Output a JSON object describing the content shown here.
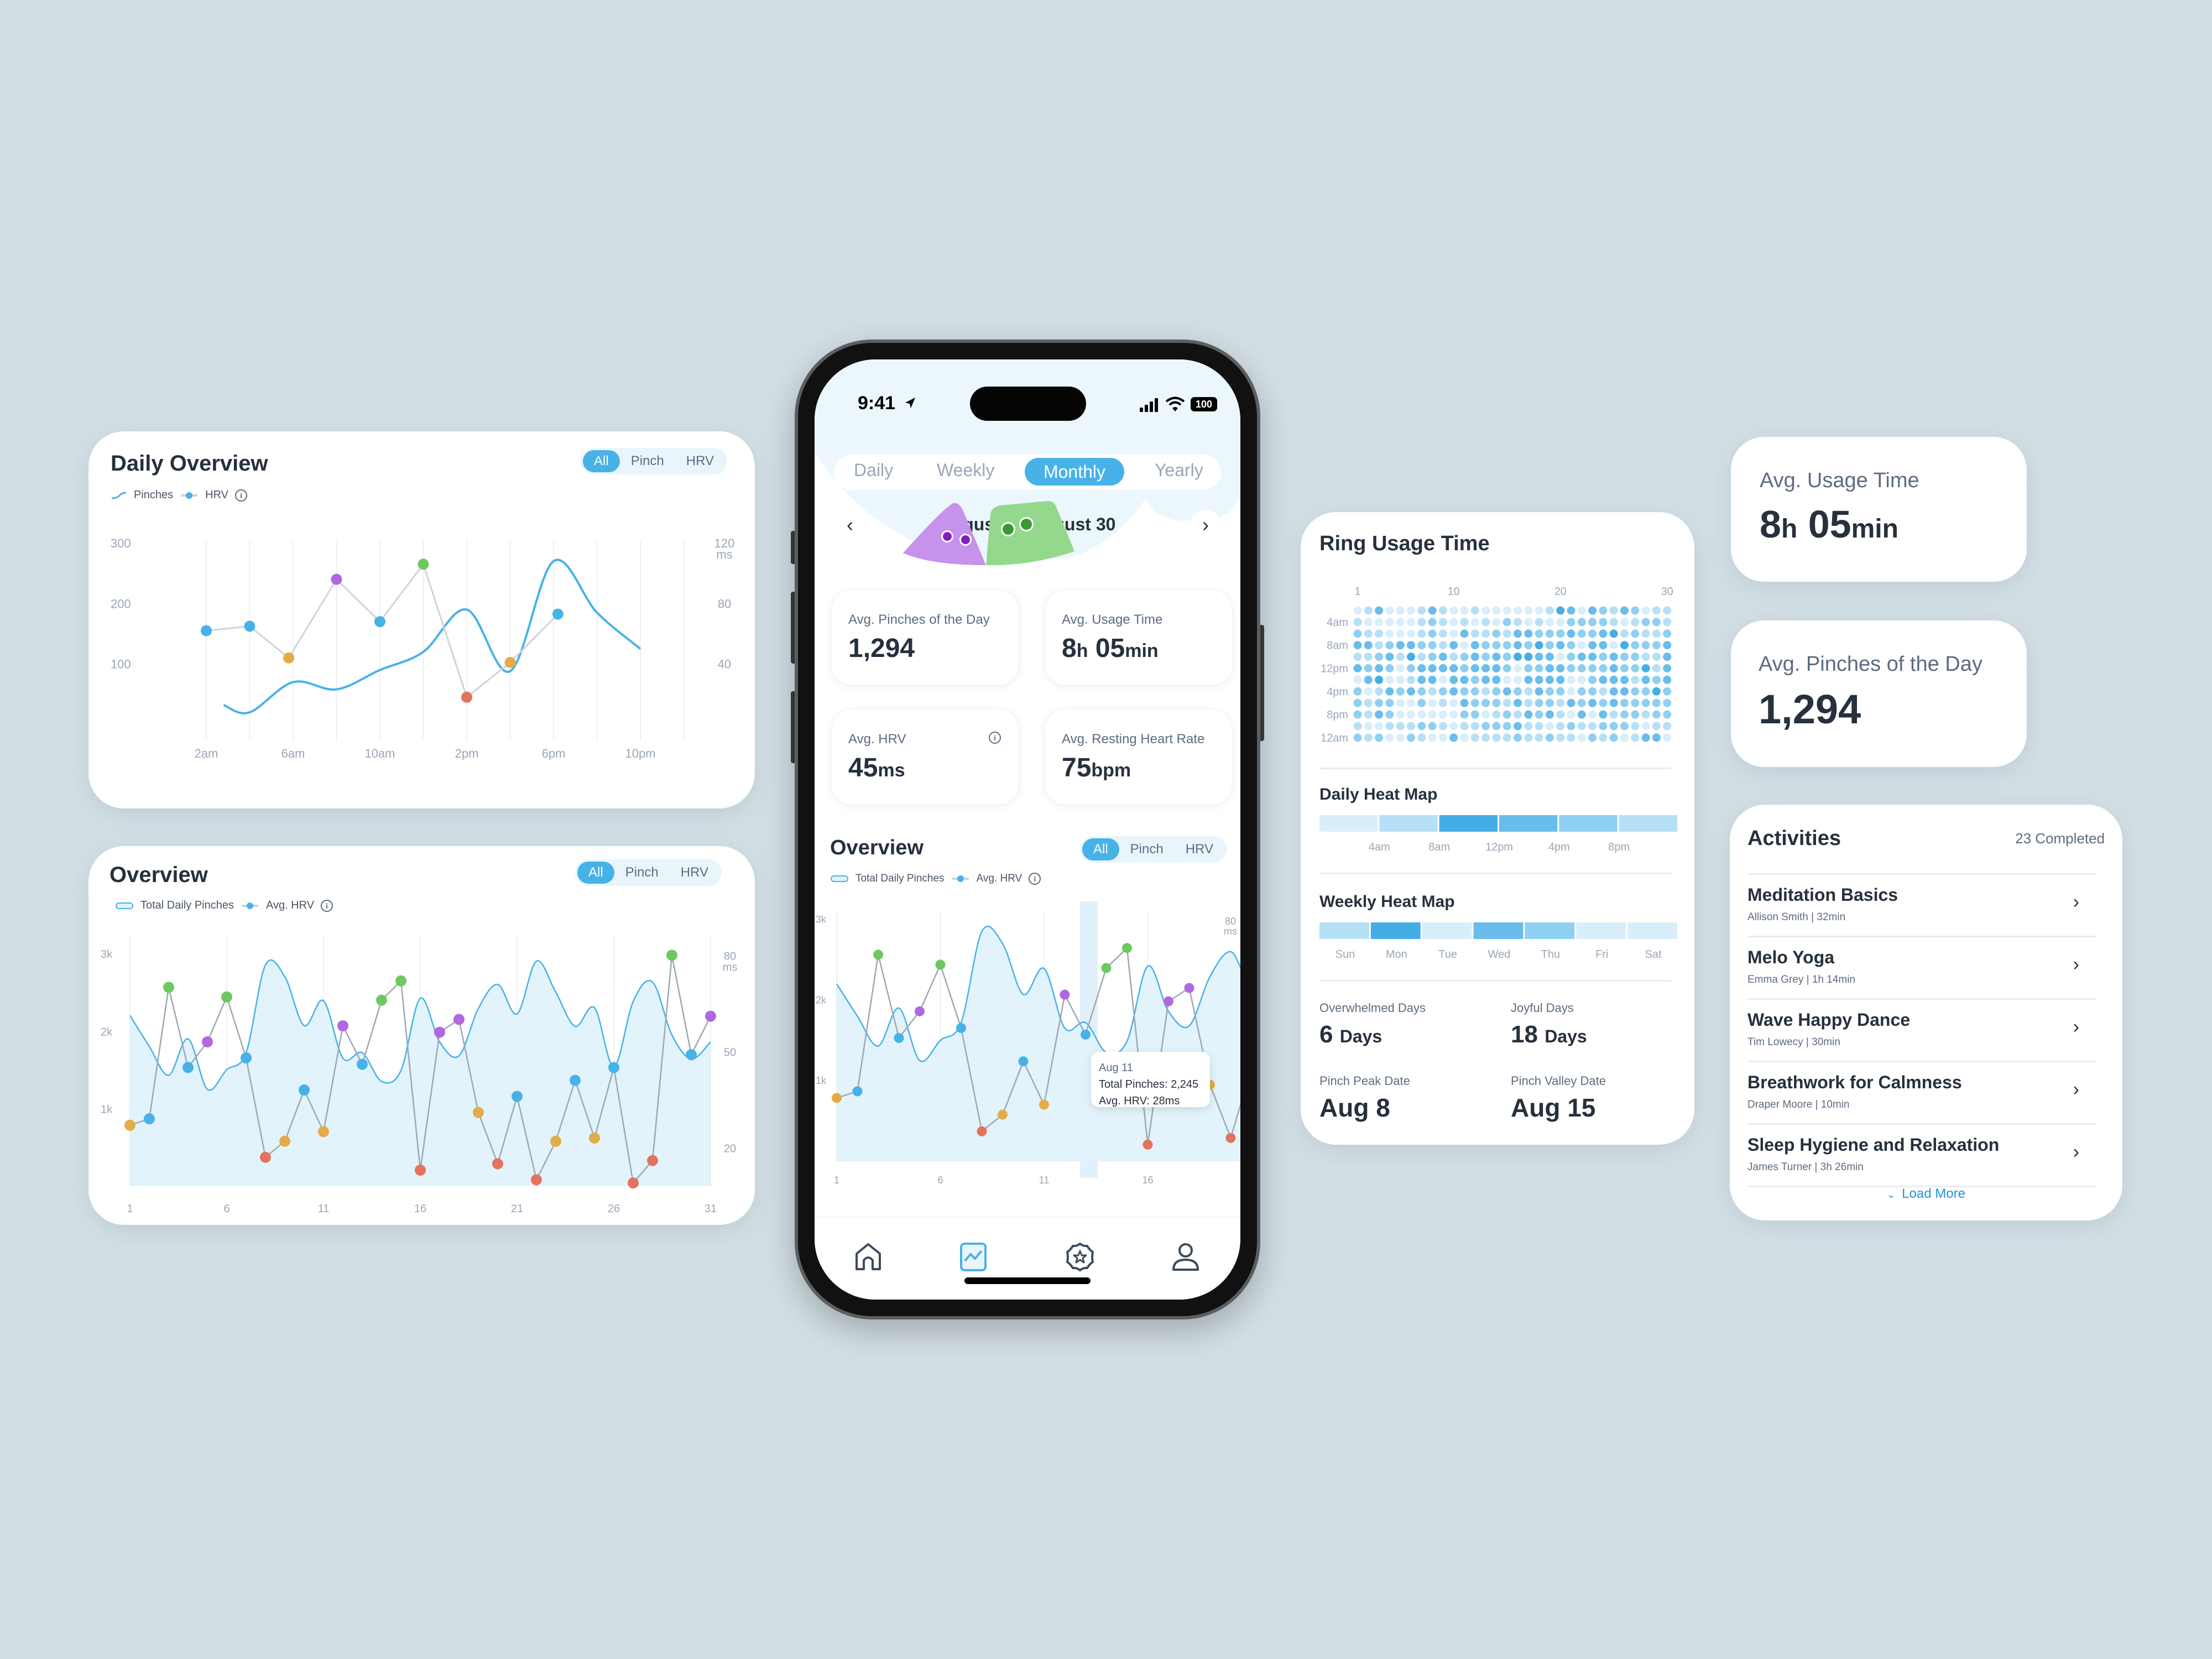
{
  "colors": {
    "background": "#d3dfe5",
    "accent": "#47b2e8",
    "text_dark": "#27303d",
    "text_muted": "#5d6b80",
    "hrv_line": "#a9b2bc",
    "pinch_fill": "#e2f3fb",
    "category": {
      "green": "#6cc95f",
      "blue": "#47b2e8",
      "purple": "#b067e0",
      "orange": "#e2ac47",
      "red": "#e4735e"
    }
  },
  "daily_overview": {
    "title": "Daily Overview",
    "filters": [
      "All",
      "Pinch",
      "HRV"
    ],
    "active_filter": "All",
    "legend": {
      "pinches": "Pinches",
      "hrv": "HRV",
      "info_icon": "info-icon"
    }
  },
  "overview_card": {
    "title": "Overview",
    "filters": [
      "All",
      "Pinch",
      "HRV"
    ],
    "active_filter": "All",
    "legend": {
      "pinches": "Total Daily Pinches",
      "hrv": "Avg. HRV",
      "info_icon": "info-icon"
    }
  },
  "chart_data": [
    {
      "id": "daily_overview",
      "type": "line",
      "title": "Daily Overview",
      "x": [
        "1am",
        "2am",
        "3am",
        "4am",
        "5am",
        "6am",
        "7am",
        "8am",
        "9am",
        "10am",
        "11am",
        "12pm",
        "1pm",
        "2pm",
        "3pm",
        "4pm",
        "5pm",
        "6pm",
        "7pm",
        "8pm",
        "9pm",
        "10pm",
        "11pm",
        "12am"
      ],
      "xticks": [
        "2am",
        "6am",
        "10am",
        "2pm",
        "6pm",
        "10pm"
      ],
      "yticks_left": [
        "100",
        "200",
        "300"
      ],
      "ylim_left": [
        0,
        300
      ],
      "yticks_right": [
        "40",
        "80",
        "120"
      ],
      "ylabel_right": "ms",
      "ylim_right": [
        0,
        120
      ],
      "grid": true,
      "legend": "top-left",
      "series": [
        {
          "name": "Pinches",
          "kind": "smooth-line",
          "points": [
            [
              1.4,
              32
            ],
            [
              2,
              20
            ],
            [
              3,
              70
            ],
            [
              4,
              58
            ],
            [
              5,
              90
            ],
            [
              6,
              120
            ],
            [
              7,
              190
            ],
            [
              8,
              88
            ],
            [
              9,
              270
            ],
            [
              10,
              185
            ],
            [
              11,
              125
            ]
          ]
        },
        {
          "name": "HRV",
          "kind": "line-markers",
          "points": [
            {
              "x": 2,
              "y": 62,
              "cat": "blue"
            },
            {
              "x": 3,
              "y": 65,
              "cat": "blue"
            },
            {
              "x": 3.9,
              "y": 44,
              "cat": "orange"
            },
            {
              "x": 5,
              "y": 96,
              "cat": "purple"
            },
            {
              "x": 6,
              "y": 68,
              "cat": "blue"
            },
            {
              "x": 7,
              "y": 106,
              "cat": "green"
            },
            {
              "x": 8,
              "y": 18,
              "cat": "red"
            },
            {
              "x": 9,
              "y": 41,
              "cat": "orange"
            },
            {
              "x": 10.1,
              "y": 73,
              "cat": "blue"
            }
          ]
        }
      ]
    },
    {
      "id": "monthly_overview",
      "type": "area",
      "title": "Overview",
      "x": [
        1,
        2,
        3,
        4,
        5,
        6,
        7,
        8,
        9,
        10,
        11,
        12,
        13,
        14,
        15,
        16,
        17,
        18,
        19,
        20,
        21,
        22,
        23,
        24,
        25,
        26,
        27,
        28,
        29,
        30,
        31
      ],
      "xticks": [
        "1",
        "6",
        "11",
        "16",
        "21",
        "26",
        "31"
      ],
      "yticks_left": [
        "1k",
        "2k",
        "3k"
      ],
      "ylim_left": [
        0,
        3100
      ],
      "yticks_right": [
        "20",
        "50",
        "80"
      ],
      "ylabel_right": "ms",
      "ylim_right": [
        8,
        83
      ],
      "grid": true,
      "legend": "top-left",
      "series": [
        {
          "name": "Total Daily Pinches",
          "values": [
            2200,
            1800,
            1430,
            1900,
            1250,
            1500,
            1720,
            2850,
            2700,
            2070,
            2390,
            1650,
            1720,
            1350,
            1490,
            2420,
            1860,
            1680,
            2290,
            2600,
            2220,
            2900,
            2500,
            2060,
            2300,
            1540,
            2380,
            2630,
            1950,
            1640,
            1860
          ]
        },
        {
          "name": "Avg. HRV",
          "values": [
            {
              "v": 27,
              "cat": "orange"
            },
            {
              "v": 29,
              "cat": "blue"
            },
            {
              "v": 70,
              "cat": "green"
            },
            {
              "v": 45,
              "cat": "blue"
            },
            {
              "v": 53,
              "cat": "purple"
            },
            {
              "v": 67,
              "cat": "green"
            },
            {
              "v": 48,
              "cat": "blue"
            },
            {
              "v": 17,
              "cat": "red"
            },
            {
              "v": 22,
              "cat": "orange"
            },
            {
              "v": 38,
              "cat": "blue"
            },
            {
              "v": 25,
              "cat": "orange"
            },
            {
              "v": 58,
              "cat": "purple"
            },
            {
              "v": 46,
              "cat": "blue"
            },
            {
              "v": 66,
              "cat": "green"
            },
            {
              "v": 72,
              "cat": "green"
            },
            {
              "v": 13,
              "cat": "red"
            },
            {
              "v": 56,
              "cat": "purple"
            },
            {
              "v": 60,
              "cat": "purple"
            },
            {
              "v": 31,
              "cat": "orange"
            },
            {
              "v": 15,
              "cat": "red"
            },
            {
              "v": 36,
              "cat": "blue"
            },
            {
              "v": 10,
              "cat": "red"
            },
            {
              "v": 22,
              "cat": "orange"
            },
            {
              "v": 41,
              "cat": "blue"
            },
            {
              "v": 23,
              "cat": "orange"
            },
            {
              "v": 45,
              "cat": "blue"
            },
            {
              "v": 9,
              "cat": "red"
            },
            {
              "v": 16,
              "cat": "red"
            },
            {
              "v": 80,
              "cat": "green"
            },
            {
              "v": 49,
              "cat": "blue"
            },
            {
              "v": 61,
              "cat": "purple"
            }
          ]
        }
      ],
      "tooltip": {
        "date": "Aug 11",
        "line1": "Total Pinches: 2,245",
        "line2": "Avg. HRV: 28ms"
      }
    },
    {
      "id": "ring_usage",
      "type": "heatmap",
      "title": "Ring Usage Time",
      "xticks": [
        "1",
        "10",
        "20",
        "30"
      ],
      "yticks": [
        "4am",
        "8am",
        "12pm",
        "4pm",
        "8pm",
        "12am"
      ],
      "rows": 12,
      "cols": 30,
      "levels": [
        "013000131001000000143032132011020122",
        "100000121010102101002222101221",
        "211000121031121332223223412112",
        "331233221303222324232033042223",
        "112314123123232443302332322113",
        "323202333323332022332222322413",
        "034001330332330033330023331323",
        "201323212322123213220221332242",
        "212200201032221312213232322222",
        "213200000022012132310303122122",
        "100111221011222311012112221011",
        "212002100301111211211021201330"
      ],
      "note": "levels 0-4 intensity per day per 2-hour slot"
    },
    {
      "id": "daily_heat_map",
      "type": "heatmap",
      "title": "Daily Heat Map",
      "categories": [
        "12am-4am",
        "4am-8am",
        "8am-12pm",
        "12pm-4pm",
        "4pm-8pm",
        "8pm-12am"
      ],
      "xticks": [
        "4am",
        "8am",
        "12pm",
        "4pm",
        "8pm"
      ],
      "levels": [
        0,
        1,
        4,
        3,
        2,
        1
      ]
    },
    {
      "id": "weekly_heat_map",
      "type": "heatmap",
      "title": "Weekly Heat Map",
      "categories": [
        "Sun",
        "Mon",
        "Tue",
        "Wed",
        "Thu",
        "Fri",
        "Sat"
      ],
      "levels": [
        1,
        4,
        0,
        3,
        2,
        0,
        0
      ]
    }
  ],
  "phone": {
    "status": {
      "time": "9:41",
      "battery": "100"
    },
    "period_tabs": [
      "Daily",
      "Weekly",
      "Monthly",
      "Yearly"
    ],
    "active_period": "Monthly",
    "date_range": "August 1 - August 30",
    "stats": [
      {
        "label": "Avg. Pinches of the Day",
        "value": "1,294",
        "unit": ""
      },
      {
        "label": "Avg. Usage Time",
        "value_h": "8",
        "unit_h": "h",
        "value_m": "05",
        "unit_m": "min"
      },
      {
        "label": "Avg. HRV",
        "value": "45",
        "unit": "ms"
      },
      {
        "label": "Avg. Resting Heart Rate",
        "value": "75",
        "unit": "bpm"
      }
    ],
    "overview": {
      "title": "Overview",
      "filters": [
        "All",
        "Pinch",
        "HRV"
      ],
      "legend_pinches": "Total Daily Pinches",
      "legend_hrv": "Avg. HRV",
      "tooltip": {
        "date": "Aug 11",
        "line1": "Total Pinches: 2,245",
        "line2": "Avg. HRV: 28ms"
      }
    },
    "tabbar": [
      "home-icon",
      "chart-icon",
      "badge-star-icon",
      "profile-icon"
    ],
    "active_tab": "chart-icon"
  },
  "ring_usage_card": {
    "title": "Ring Usage Time",
    "daily_heat_title": "Daily Heat Map",
    "daily_heat_ticks": [
      "4am",
      "8am",
      "12pm",
      "4pm",
      "8pm"
    ],
    "weekly_heat_title": "Weekly Heat Map",
    "weekly_days": [
      "Sun",
      "Mon",
      "Tue",
      "Wed",
      "Thu",
      "Fri",
      "Sat"
    ],
    "stats": [
      {
        "label": "Overwhelmed Days",
        "value": "6",
        "unit": "Days"
      },
      {
        "label": "Joyful Days",
        "value": "18",
        "unit": "Days"
      },
      {
        "label": "Pinch Peak Date",
        "value": "Aug 8",
        "unit": ""
      },
      {
        "label": "Pinch Valley Date",
        "value": "Aug 15",
        "unit": ""
      }
    ]
  },
  "usage_card": {
    "label": "Avg. Usage Time",
    "h": "8",
    "h_unit": "h",
    "m": "05",
    "m_unit": "min"
  },
  "pinches_card": {
    "label": "Avg. Pinches of the Day",
    "value": "1,294"
  },
  "activities": {
    "title": "Activities",
    "completed": "23 Completed",
    "items": [
      {
        "name": "Meditation Basics",
        "meta": "Allison Smith | 32min"
      },
      {
        "name": "Melo Yoga",
        "meta": "Emma Grey | 1h 14min"
      },
      {
        "name": "Wave Happy Dance",
        "meta": "Tim Lowecy | 30min"
      },
      {
        "name": "Breathwork for Calmness",
        "meta": "Draper Moore | 10min"
      },
      {
        "name": "Sleep Hygiene and Relaxation",
        "meta": "James Turner | 3h 26min"
      }
    ],
    "load_more": "Load More"
  }
}
